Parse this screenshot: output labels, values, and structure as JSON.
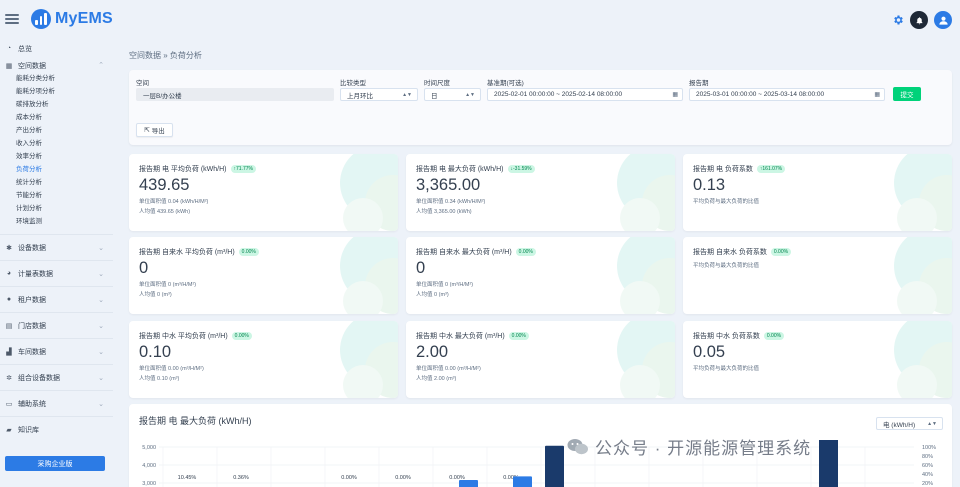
{
  "app": {
    "name": "MyEMS"
  },
  "sidebar": {
    "overview": "总览",
    "space_data": "空间数据",
    "space_items": [
      "能耗分类分析",
      "能耗分项分析",
      "碳排放分析",
      "成本分析",
      "产出分析",
      "收入分析",
      "效率分析",
      "负荷分析",
      "统计分析",
      "节能分析",
      "计划分析",
      "环境监测"
    ],
    "active_index": 7,
    "groups": [
      {
        "label": "设备数据",
        "icon": "gear-icon"
      },
      {
        "label": "计量表数据",
        "icon": "pie-icon"
      },
      {
        "label": "租户数据",
        "icon": "user-icon"
      },
      {
        "label": "门店数据",
        "icon": "store-icon"
      },
      {
        "label": "车间数据",
        "icon": "factory-icon"
      },
      {
        "label": "组合设备数据",
        "icon": "gears-icon"
      },
      {
        "label": "辅助系统",
        "icon": "monitor-icon"
      },
      {
        "label": "知识库",
        "icon": "folder-icon"
      }
    ],
    "buy_button": "采购企业版"
  },
  "breadcrumb": "空间数据 » 负荷分析",
  "filters": {
    "space_label": "空间",
    "space_value": "一层B/办公楼",
    "compare_label": "比较类型",
    "compare_value": "上月环比",
    "period_label": "时间尺度",
    "period_value": "日",
    "base_label": "基准期(可选)",
    "base_value": "2025-02-01 00:00:00 ~ 2025-02-14 08:00:00",
    "report_label": "报告期",
    "report_value": "2025-03-01 00:00:00 ~ 2025-03-14 08:00:00",
    "submit": "提交",
    "export": "导出"
  },
  "kpis": [
    {
      "title": "报告期 电 平均负荷 (kWh/H)",
      "badge": "↑71.77%",
      "value": "439.65",
      "sub1": "单位面积值 0.04 (kWh/H/M²)",
      "sub2": "人均值 439.65 (kWh)"
    },
    {
      "title": "报告期 电 最大负荷 (kWh/H)",
      "badge": "↓-31.59%",
      "value": "3,365.00",
      "sub1": "单位面积值 0.34 (kWh/H/M²)",
      "sub2": "人均值 3,365.00 (kWh)"
    },
    {
      "title": "报告期 电 负荷系数",
      "badge": "↑161.07%",
      "value": "0.13",
      "sub1": "平均负荷与最大负荷的比值",
      "sub2": ""
    },
    {
      "title": "报告期 自来水 平均负荷 (m³/H)",
      "badge": "0.00%",
      "value": "0",
      "sub1": "单位面积值 0 (m³/H/M²)",
      "sub2": "人均值 0 (m³)"
    },
    {
      "title": "报告期 自来水 最大负荷 (m³/H)",
      "badge": "0.00%",
      "value": "0",
      "sub1": "单位面积值 0 (m³/H/M²)",
      "sub2": "人均值 0 (m³)"
    },
    {
      "title": "报告期 自来水 负荷系数",
      "badge": "0.00%",
      "value": "",
      "sub1": "平均负荷与最大负荷的比值",
      "sub2": ""
    },
    {
      "title": "报告期 中水 平均负荷 (m³/H)",
      "badge": "0.00%",
      "value": "0.10",
      "sub1": "单位面积值 0.00 (m³/H/M²)",
      "sub2": "人均值 0.10 (m³)"
    },
    {
      "title": "报告期 中水 最大负荷 (m³/H)",
      "badge": "0.00%",
      "value": "2.00",
      "sub1": "单位面积值 0.00 (m³/H/M²)",
      "sub2": "人均值 2.00 (m³)"
    },
    {
      "title": "报告期 中水 负荷系数",
      "badge": "0.00%",
      "value": "0.05",
      "sub1": "平均负荷与最大负荷的比值",
      "sub2": ""
    }
  ],
  "chart_section": {
    "title": "报告期 电 最大负荷 (kWh/H)",
    "unit_select": "电 (kWh/H)"
  },
  "chart_data": {
    "type": "bar",
    "y_ticks": [
      "5,000",
      "4,000",
      "3,000"
    ],
    "y2_ticks": [
      "100%",
      "80%",
      "60%",
      "40%",
      "20%"
    ],
    "pct_labels": [
      "10.45%",
      "0.36%",
      "0.00%",
      "0.00%",
      "0.00%",
      "0.00%"
    ],
    "bars": [
      {
        "value": 2400,
        "color": "#2c7be5"
      },
      {
        "value": 2600,
        "color": "#2c7be5"
      },
      {
        "value": 4300,
        "color": "#1a3a6b"
      },
      {
        "value": 4800,
        "color": "#1a3a6b"
      }
    ],
    "ylim": [
      0,
      5000
    ]
  },
  "watermark": "公众号 · 开源能源管理系统"
}
